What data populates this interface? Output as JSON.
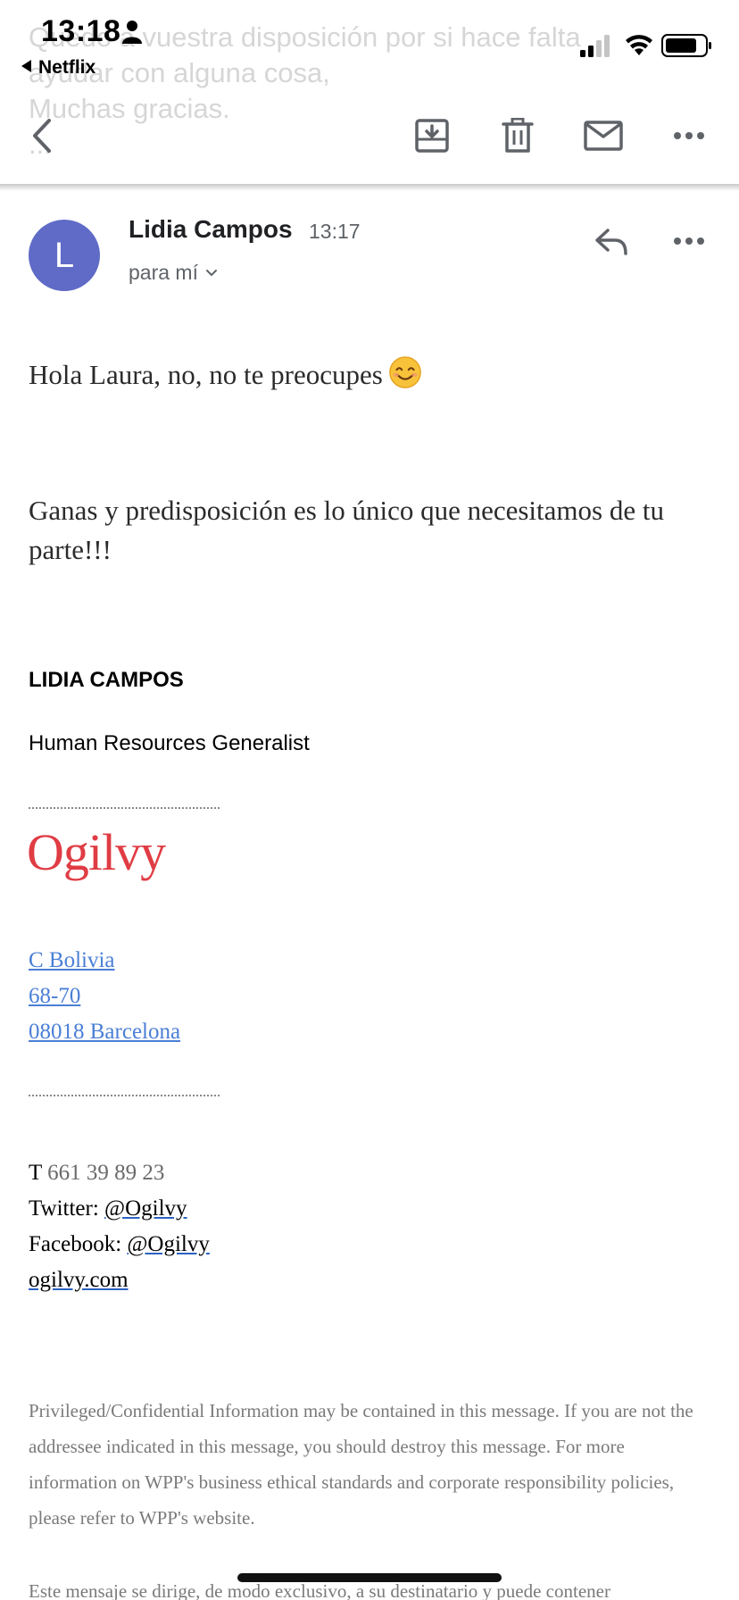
{
  "status_bar": {
    "time": "13:18",
    "back_app": "Netflix"
  },
  "header_scrolled_text": [
    "Quedo a vuestra disposición por si hace falta",
    "ayudar con alguna cosa,",
    "Muchas gracias.",
    "..."
  ],
  "toolbar": {
    "back_icon": "chevron-left-icon",
    "archive_icon": "archive-icon",
    "delete_icon": "trash-icon",
    "mark_unread_icon": "mail-icon",
    "more_icon": "more-horizontal-icon"
  },
  "message": {
    "avatar_letter": "L",
    "avatar_color": "#5f6bc7",
    "sender": "Lidia Campos",
    "time": "13:17",
    "recipient": "para mí",
    "body": [
      "Hola Laura, no, no te preocupes",
      "Ganas y predisposición es lo único que necesitamos de tu parte!!!"
    ]
  },
  "signature": {
    "name": "LIDIA CAMPOS",
    "title": "Human Resources Generalist",
    "logo": "Ogilvy",
    "logo_color": "#e03c44",
    "address": [
      "C Bolivia",
      "68-70",
      "08018 Barcelona"
    ],
    "phone_label": "T",
    "phone": "661 39 89 23",
    "twitter_label": "Twitter:",
    "twitter": "@Ogilvy",
    "facebook_label": "Facebook:",
    "facebook": "@Ogilvy",
    "website": "ogilvy.com"
  },
  "disclaimer": {
    "en": "Privileged/Confidential Information may be contained in this message. If you are not the addressee indicated in this message, you should destroy this message. For more information on WPP's business ethical standards and corporate responsibility policies, please refer to WPP's website.",
    "es_partial": "Este mensaje se dirige, de modo exclusivo, a su destinatario y puede contener"
  }
}
